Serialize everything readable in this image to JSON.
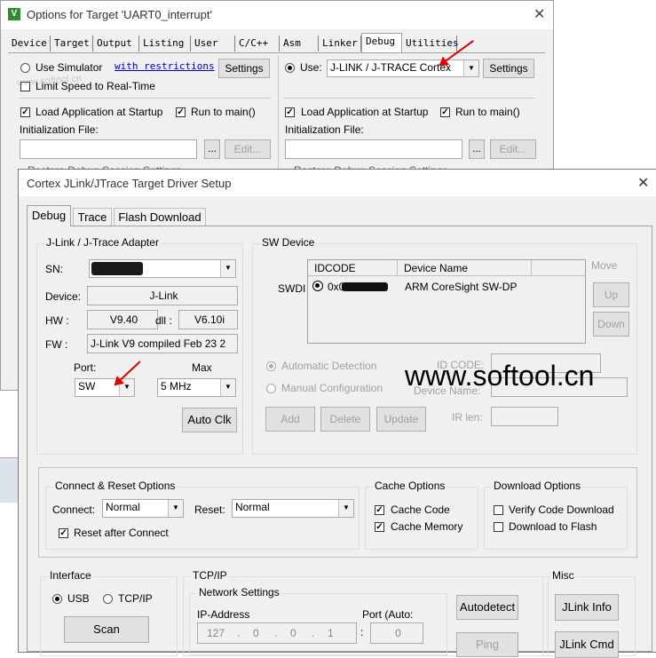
{
  "options_window": {
    "title": "Options for Target 'UART0_interrupt'",
    "tabs": [
      "Device",
      "Target",
      "Output",
      "Listing",
      "User",
      "C/C++",
      "Asm",
      "Linker",
      "Debug",
      "Utilities"
    ],
    "active_tab": "Debug",
    "use_simulator_label": "Use Simulator",
    "with_restrictions_link": "with restrictions",
    "settings_label": "Settings",
    "limit_speed_label": "Limit Speed to Real-Time",
    "use_label": "Use:",
    "debugger_value": "J-LINK / J-TRACE Cortex",
    "load_app_label": "Load Application at Startup",
    "run_to_main_label": "Run to main()",
    "init_file_label": "Initialization File:",
    "browse_label": "...",
    "edit_label": "Edit...",
    "restore_label": "Restore Debug Session Settings"
  },
  "watermark_small": "www.softool.cn",
  "watermark_large": "www.softool.cn",
  "driver_window": {
    "title": "Cortex JLink/JTrace Target Driver Setup",
    "tabs": [
      "Debug",
      "Trace",
      "Flash Download"
    ],
    "active_tab": "Debug",
    "adapter": {
      "group_title": "J-Link / J-Trace Adapter",
      "sn_label": "SN:",
      "sn_value": "",
      "device_label": "Device:",
      "device_value": "J-Link",
      "hw_label": "HW :",
      "hw_value": "V9.40",
      "dll_label": "dll :",
      "dll_value": "V6.10i",
      "fw_label": "FW :",
      "fw_value": "J-Link V9 compiled Feb 23 2",
      "port_label": "Port:",
      "port_value": "SW",
      "max_label": "Max",
      "max_value": "5 MHz",
      "auto_clk_label": "Auto Clk"
    },
    "sw_device": {
      "group_title": "SW Device",
      "swdi_label": "SWDI",
      "col_idcode": "IDCODE",
      "col_device_name": "Device Name",
      "row_idcode": "0x0",
      "row_device_name": "ARM CoreSight SW-DP",
      "move_label": "Move",
      "up_label": "Up",
      "down_label": "Down",
      "auto_detect_label": "Automatic Detection",
      "manual_config_label": "Manual Configuration",
      "id_code_label": "ID CODE:",
      "device_name_label": "Device Name:",
      "ir_len_label": "IR len:",
      "add_label": "Add",
      "delete_label": "Delete",
      "update_label": "Update"
    },
    "connect_reset": {
      "group_title": "Connect & Reset Options",
      "connect_label": "Connect:",
      "connect_value": "Normal",
      "reset_label": "Reset:",
      "reset_value": "Normal",
      "reset_after_connect_label": "Reset after Connect"
    },
    "cache": {
      "group_title": "Cache Options",
      "cache_code_label": "Cache Code",
      "cache_memory_label": "Cache Memory"
    },
    "download": {
      "group_title": "Download Options",
      "verify_label": "Verify Code Download",
      "download_flash_label": "Download to Flash"
    },
    "interface": {
      "group_title": "Interface",
      "usb_label": "USB",
      "tcpip_label": "TCP/IP",
      "scan_label": "Scan"
    },
    "tcpip": {
      "group_title": "TCP/IP",
      "network_settings_label": "Network Settings",
      "ip_label": "IP-Address",
      "ip_parts": [
        "127",
        "0",
        "0",
        "1"
      ],
      "port_label": "Port (Auto:",
      "port_value": "0",
      "autodetect_label": "Autodetect",
      "ping_label": "Ping"
    },
    "misc": {
      "group_title": "Misc",
      "jlink_info_label": "JLink Info",
      "jlink_cmd_label": "JLink Cmd"
    }
  }
}
